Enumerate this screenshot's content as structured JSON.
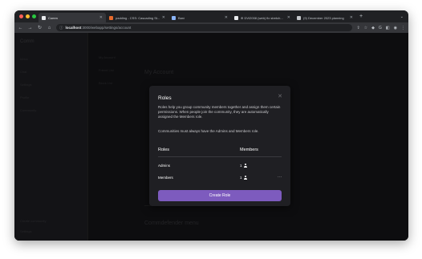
{
  "browser": {
    "tabs": [
      {
        "label": "Comm",
        "active": true
      },
      {
        "label": "padding - CSS: Cascading St...",
        "active": false
      },
      {
        "label": "Bard",
        "active": false
      },
      {
        "label": "⊕ DVI2008 (web) fix stretch...",
        "active": false
      },
      {
        "label": "(9) December 2023 planning",
        "active": false
      }
    ],
    "url_host": "localhost",
    "url_path": ":3000/webapp/settings/account",
    "colors": {
      "close": "#ff5f57",
      "minimize": "#febc2e",
      "maximize": "#28c840"
    }
  },
  "app": {
    "brand": "Comm",
    "sidebar_items": [
      "Inbox",
      "Chat",
      "Settings",
      "Profile",
      "Community"
    ],
    "sidebar_bottom": [
      "Create community",
      "Settings"
    ],
    "col2_items": [
      "My Account",
      "Friend List",
      "Block List"
    ],
    "main_title": "My Account",
    "bottom_title": "Commdefender menu"
  },
  "modal": {
    "title": "Roles",
    "description_1": "Roles help you group community members together and assign them certain permissions. When people join the community, they are automatically assigned the Members role.",
    "description_2": "Communities must always have the Admins and Members role.",
    "col_roles": "Roles",
    "col_members": "Members",
    "rows": [
      {
        "name": "Admins",
        "count": "1"
      },
      {
        "name": "Members",
        "count": "1"
      }
    ],
    "more_label": "···",
    "create_button": "Create Role",
    "accent": "#7d5bbe"
  }
}
